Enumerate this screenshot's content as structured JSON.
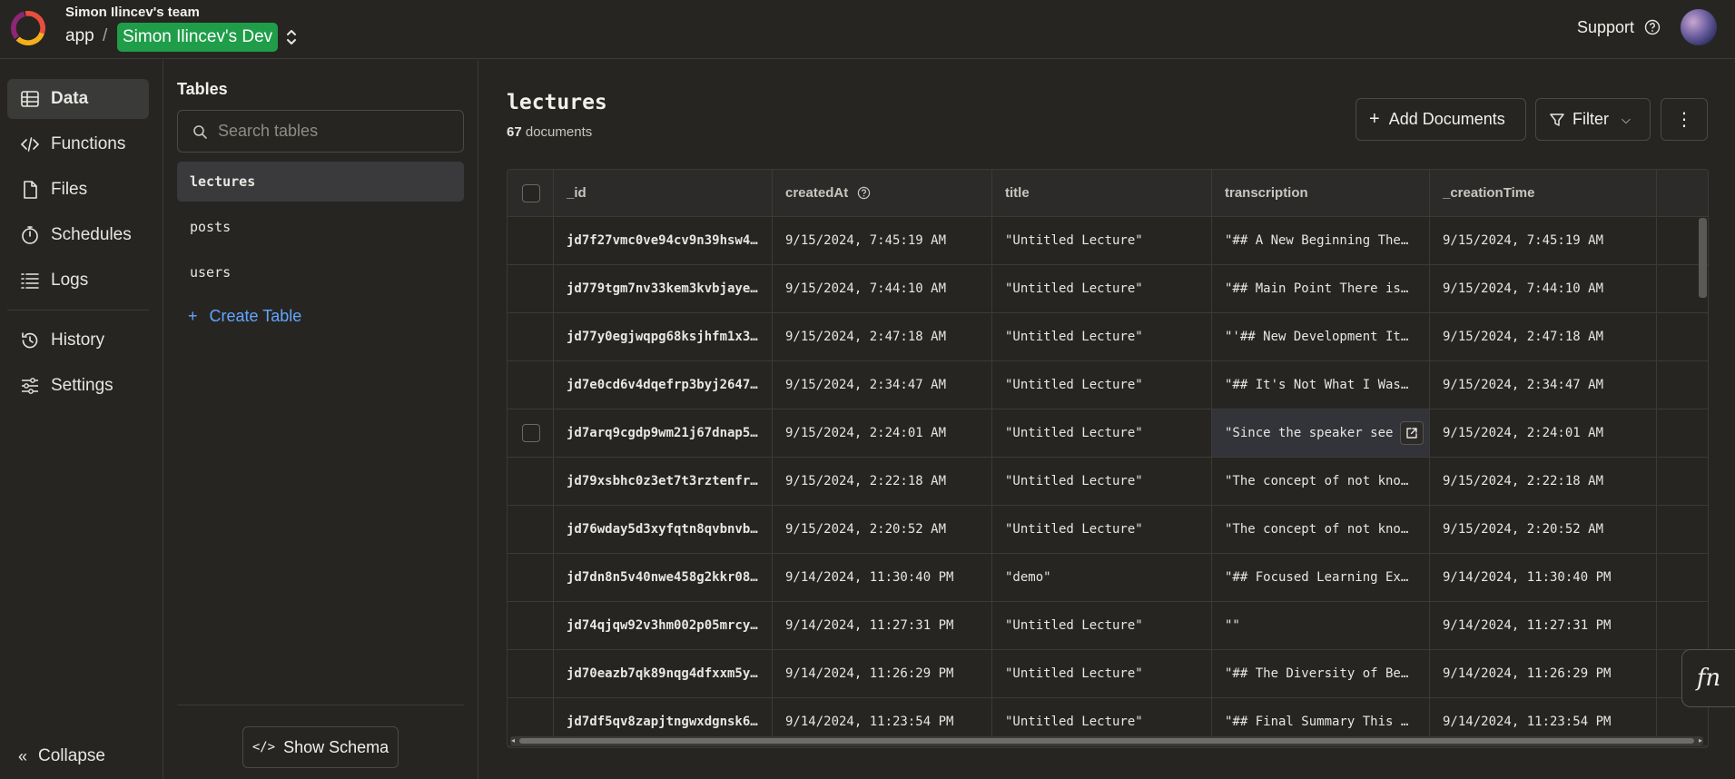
{
  "header": {
    "team": "Simon Ilincev's team",
    "project": "app",
    "separator": "/",
    "deployment": "Simon Ilincev's Dev",
    "support_label": "Support"
  },
  "nav": {
    "items": [
      {
        "label": "Data",
        "icon": "table-icon",
        "active": true
      },
      {
        "label": "Functions",
        "icon": "code-icon"
      },
      {
        "label": "Files",
        "icon": "file-icon"
      },
      {
        "label": "Schedules",
        "icon": "stopwatch-icon"
      },
      {
        "label": "Logs",
        "icon": "list-icon"
      },
      {
        "label": "History",
        "icon": "history-icon"
      },
      {
        "label": "Settings",
        "icon": "sliders-icon"
      }
    ],
    "collapse_label": "Collapse"
  },
  "tables_panel": {
    "title": "Tables",
    "search_placeholder": "Search tables",
    "tables": [
      "lectures",
      "posts",
      "users"
    ],
    "create_label": "Create Table",
    "show_schema_label": "Show Schema"
  },
  "main": {
    "title": "lectures",
    "count": "67",
    "count_suffix": "documents",
    "add_label": "Add Documents",
    "filter_label": "Filter",
    "columns": [
      "_id",
      "createdAt",
      "title",
      "transcription",
      "_creationTime"
    ],
    "rows": [
      {
        "id": "jd7f27vmc0ve94cv9n39hsw4…",
        "createdAt": "9/15/2024, 7:45:19 AM",
        "title": "\"Untitled Lecture\"",
        "transcription": "\"## A New Beginning The …",
        "creationTime": "9/15/2024, 7:45:19 AM"
      },
      {
        "id": "jd779tgm7nv33kem3kvbjaye…",
        "createdAt": "9/15/2024, 7:44:10 AM",
        "title": "\"Untitled Lecture\"",
        "transcription": "\"## Main Point There is …",
        "creationTime": "9/15/2024, 7:44:10 AM"
      },
      {
        "id": "jd77y0egjwqpg68ksjhfm1x3…",
        "createdAt": "9/15/2024, 2:47:18 AM",
        "title": "\"Untitled Lecture\"",
        "transcription": "\"'## New Development It …",
        "creationTime": "9/15/2024, 2:47:18 AM"
      },
      {
        "id": "jd7e0cd6v4dqefrp3byj2647…",
        "createdAt": "9/15/2024, 2:34:47 AM",
        "title": "\"Untitled Lecture\"",
        "transcription": "\"## It's Not What I Was …",
        "creationTime": "9/15/2024, 2:34:47 AM"
      },
      {
        "id": "jd7arq9cgdp9wm21j67dnap5…",
        "createdAt": "9/15/2024, 2:24:01 AM",
        "title": "\"Untitled Lecture\"",
        "transcription": "\"Since the speaker see",
        "creationTime": "9/15/2024, 2:24:01 AM"
      },
      {
        "id": "jd79xsbhc0z3et7t3rztenfr…",
        "createdAt": "9/15/2024, 2:22:18 AM",
        "title": "\"Untitled Lecture\"",
        "transcription": "\"The concept of not know…",
        "creationTime": "9/15/2024, 2:22:18 AM"
      },
      {
        "id": "jd76wday5d3xyfqtn8qvbnvb…",
        "createdAt": "9/15/2024, 2:20:52 AM",
        "title": "\"Untitled Lecture\"",
        "transcription": "\"The concept of not know…",
        "creationTime": "9/15/2024, 2:20:52 AM"
      },
      {
        "id": "jd7dn8n5v40nwe458g2kkr08…",
        "createdAt": "9/14/2024, 11:30:40 PM",
        "title": "\"demo\"",
        "transcription": "\"## Focused Learning Exp…",
        "creationTime": "9/14/2024, 11:30:40 PM"
      },
      {
        "id": "jd74qjqw92v3hm002p05mrcy…",
        "createdAt": "9/14/2024, 11:27:31 PM",
        "title": "\"Untitled Lecture\"",
        "transcription": "\"\"",
        "creationTime": "9/14/2024, 11:27:31 PM"
      },
      {
        "id": "jd70eazb7qk89nqg4dfxxm5y…",
        "createdAt": "9/14/2024, 11:26:29 PM",
        "title": "\"Untitled Lecture\"",
        "transcription": "\"## The Diversity of Bea…",
        "creationTime": "9/14/2024, 11:26:29 PM"
      },
      {
        "id": "jd7df5qv8zapjtngwxdgnsk6…",
        "createdAt": "9/14/2024, 11:23:54 PM",
        "title": "\"Untitled Lecture\"",
        "transcription": "\"## Final Summary This s…",
        "creationTime": "9/14/2024, 11:23:54 PM"
      }
    ]
  },
  "fn_label": "fn",
  "colors": {
    "accent_green": "#1f9d49",
    "link_blue": "#63a6ff",
    "background": "#262522"
  }
}
